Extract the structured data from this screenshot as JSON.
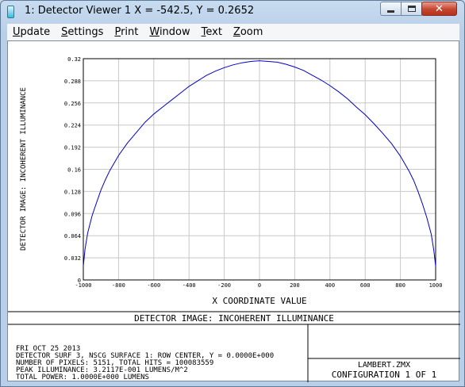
{
  "window": {
    "title": "1: Detector Viewer 1 X = -542.5, Y = 0.2652",
    "controls": {
      "minimize": "minimize",
      "maximize": "maximize",
      "close": "✕"
    }
  },
  "menu": [
    {
      "accel": "U",
      "rest": "pdate"
    },
    {
      "accel": "S",
      "rest": "ettings"
    },
    {
      "accel": "P",
      "rest": "rint"
    },
    {
      "accel": "W",
      "rest": "indow"
    },
    {
      "accel": "T",
      "rest": "ext"
    },
    {
      "accel": "Z",
      "rest": "oom"
    }
  ],
  "chart_data": {
    "type": "line",
    "xlabel": "X COORDINATE VALUE",
    "ylabel": "DETECTOR IMAGE: INCOHERENT ILLUMINANCE",
    "xlim": [
      -1000,
      1000
    ],
    "ylim": [
      0,
      0.32
    ],
    "x_ticks": [
      "-1000",
      "-800",
      "-600",
      "-400",
      "-200",
      "0",
      "200",
      "400",
      "600",
      "800",
      "1000"
    ],
    "y_ticks": [
      "0",
      "0.032",
      "0.064",
      "0.096",
      "0.128",
      "0.16",
      "0.192",
      "0.224",
      "0.256",
      "0.288",
      "0.32"
    ],
    "grid": true,
    "series": [
      {
        "color": "#0000c8",
        "x": [
          -1000,
          -990,
          -975,
          -950,
          -925,
          -900,
          -875,
          -850,
          -800,
          -750,
          -700,
          -650,
          -600,
          -550,
          -500,
          -450,
          -400,
          -350,
          -300,
          -250,
          -200,
          -150,
          -100,
          -50,
          0,
          50,
          100,
          150,
          200,
          250,
          300,
          350,
          400,
          450,
          500,
          550,
          600,
          650,
          700,
          750,
          800,
          850,
          875,
          900,
          925,
          950,
          975,
          990,
          1000
        ],
        "y": [
          0.02,
          0.045,
          0.068,
          0.093,
          0.112,
          0.13,
          0.145,
          0.158,
          0.18,
          0.198,
          0.213,
          0.228,
          0.24,
          0.25,
          0.26,
          0.27,
          0.28,
          0.288,
          0.296,
          0.302,
          0.307,
          0.311,
          0.314,
          0.316,
          0.317,
          0.316,
          0.315,
          0.312,
          0.308,
          0.303,
          0.296,
          0.289,
          0.281,
          0.272,
          0.262,
          0.25,
          0.239,
          0.226,
          0.212,
          0.197,
          0.179,
          0.157,
          0.144,
          0.128,
          0.11,
          0.09,
          0.066,
          0.042,
          0.02
        ]
      }
    ]
  },
  "caption": "DETECTOR IMAGE: INCOHERENT ILLUMINANCE",
  "info_lines": [
    "FRI OCT 25 2013",
    "DETECTOR SURF 3, NSCG SURFACE 1: ROW CENTER, Y = 0.0000E+000",
    "NUMBER OF PIXELS: 5151, TOTAL HITS = 100083559",
    "PEAK ILLUMINANCE: 3.2117E-001 LUMENS/M^2",
    "TOTAL POWER: 1.0000E+000 LUMENS"
  ],
  "file_name": "LAMBERT.ZMX",
  "configuration": "CONFIGURATION 1 OF 1"
}
